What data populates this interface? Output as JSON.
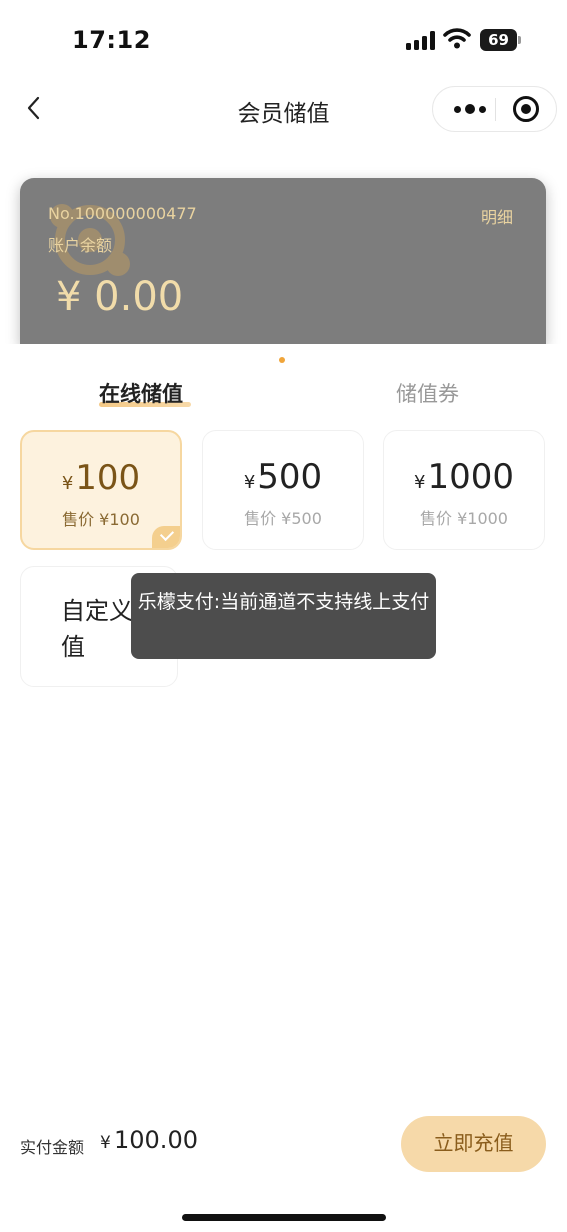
{
  "status_bar": {
    "time": "17:12",
    "battery_level": "69",
    "icons": [
      "signal-icon",
      "wifi-icon",
      "battery-icon"
    ]
  },
  "nav": {
    "title": "会员储值",
    "icons": [
      "back-icon",
      "more-icon",
      "target-icon"
    ]
  },
  "card": {
    "number": "No.100000000477",
    "detail_link": "明细",
    "balance_label": "账户余额",
    "balance": "¥ 0.00"
  },
  "tabs": [
    {
      "label": "在线储值",
      "active": true
    },
    {
      "label": "储值券",
      "active": false
    }
  ],
  "options": [
    {
      "currency": "¥",
      "amount": "100",
      "price": "售价 ¥100",
      "selected": true
    },
    {
      "currency": "¥",
      "amount": "500",
      "price": "售价 ¥500",
      "selected": false
    },
    {
      "currency": "¥",
      "amount": "1000",
      "price": "售价 ¥1000",
      "selected": false
    }
  ],
  "custom_option": {
    "label": "自定义面值"
  },
  "toast": {
    "message": "乐檬支付:当前通道不支持线上支付"
  },
  "footer": {
    "pay_label": "实付金额",
    "currency": "¥",
    "pay_amount": "100.00",
    "recharge_button": "立即充值"
  },
  "colors": {
    "accent": "#f6d9a9",
    "accent_text": "#8a5d1c",
    "card_bg": "#7d7d7d",
    "card_text": "#e9d3a0",
    "toast_bg": "#4d4d4d",
    "selected_bg": "#fdf2de"
  }
}
